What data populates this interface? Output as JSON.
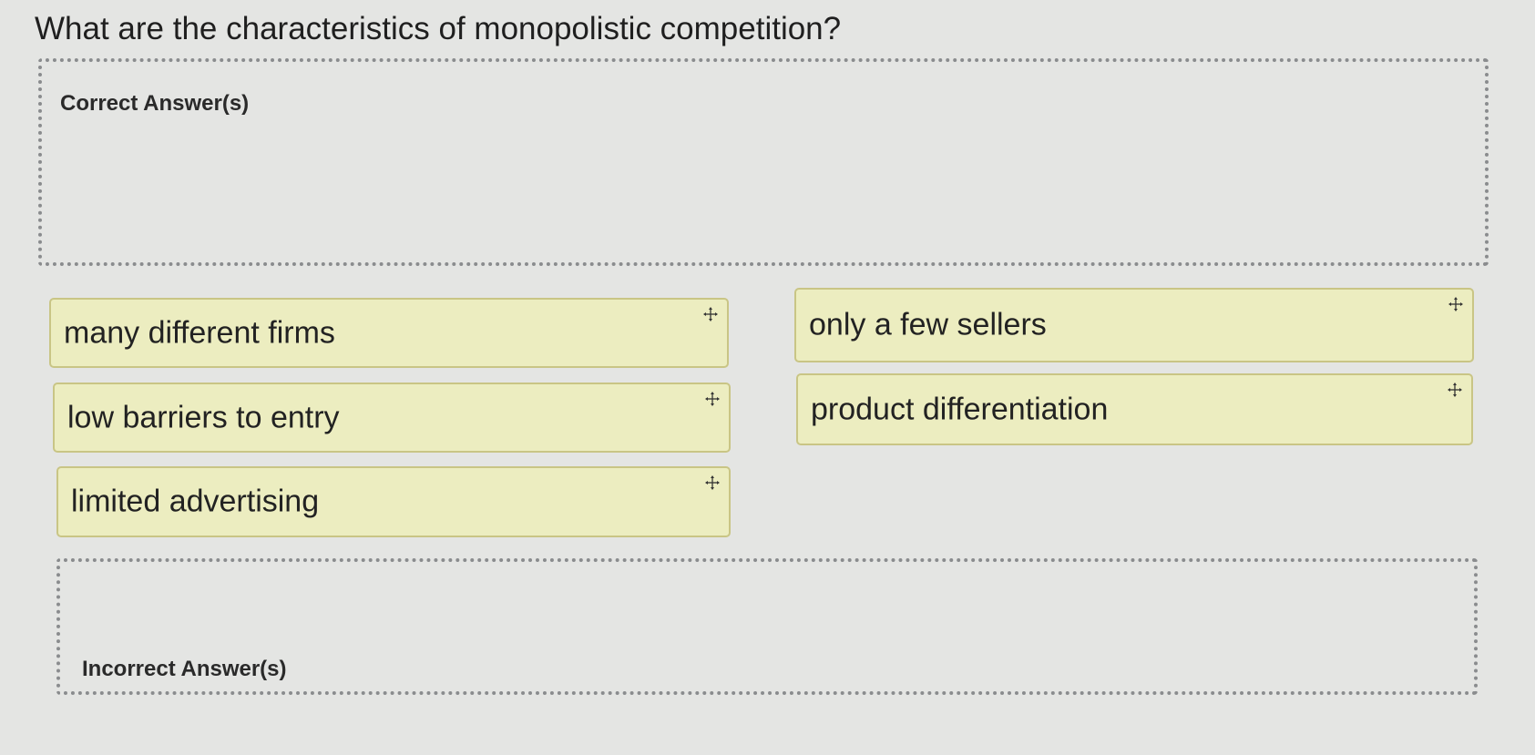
{
  "question": "What are the characteristics of monopolistic competition?",
  "correct_zone": {
    "label": "Correct Answer(s)"
  },
  "incorrect_zone": {
    "label": "Incorrect Answer(s)"
  },
  "choices": [
    {
      "label": "many different firms"
    },
    {
      "label": "only a few sellers"
    },
    {
      "label": "low barriers to entry"
    },
    {
      "label": "product differentiation"
    },
    {
      "label": "limited advertising"
    }
  ],
  "colors": {
    "background": "#e4e5e3",
    "chip_fill": "#ecedc0",
    "chip_border": "#c9c585",
    "zone_border": "#8a8c8e"
  },
  "icons": {
    "drag": "move-icon"
  }
}
